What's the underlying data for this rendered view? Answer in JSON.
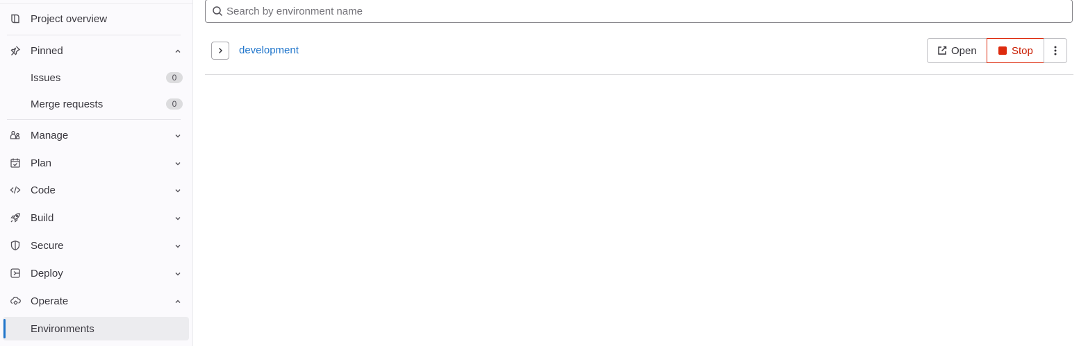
{
  "sidebar": {
    "project_overview": "Project overview",
    "pinned": {
      "label": "Pinned",
      "items": [
        {
          "label": "Issues",
          "count": "0"
        },
        {
          "label": "Merge requests",
          "count": "0"
        }
      ]
    },
    "sections": [
      {
        "label": "Manage",
        "icon": "users-icon"
      },
      {
        "label": "Plan",
        "icon": "calendar-check-icon"
      },
      {
        "label": "Code",
        "icon": "code-icon"
      },
      {
        "label": "Build",
        "icon": "rocket-icon"
      },
      {
        "label": "Secure",
        "icon": "shield-icon"
      },
      {
        "label": "Deploy",
        "icon": "deploy-icon"
      },
      {
        "label": "Operate",
        "icon": "cloud-gear-icon"
      }
    ],
    "active_item": "Environments"
  },
  "main": {
    "search": {
      "placeholder": "Search by environment name",
      "value": ""
    },
    "environments": [
      {
        "name": "development"
      }
    ],
    "actions": {
      "open_label": "Open",
      "stop_label": "Stop"
    }
  },
  "colors": {
    "link": "#1f75cb",
    "stop": "#dd2b0e",
    "active_indicator": "#1f75cb"
  }
}
